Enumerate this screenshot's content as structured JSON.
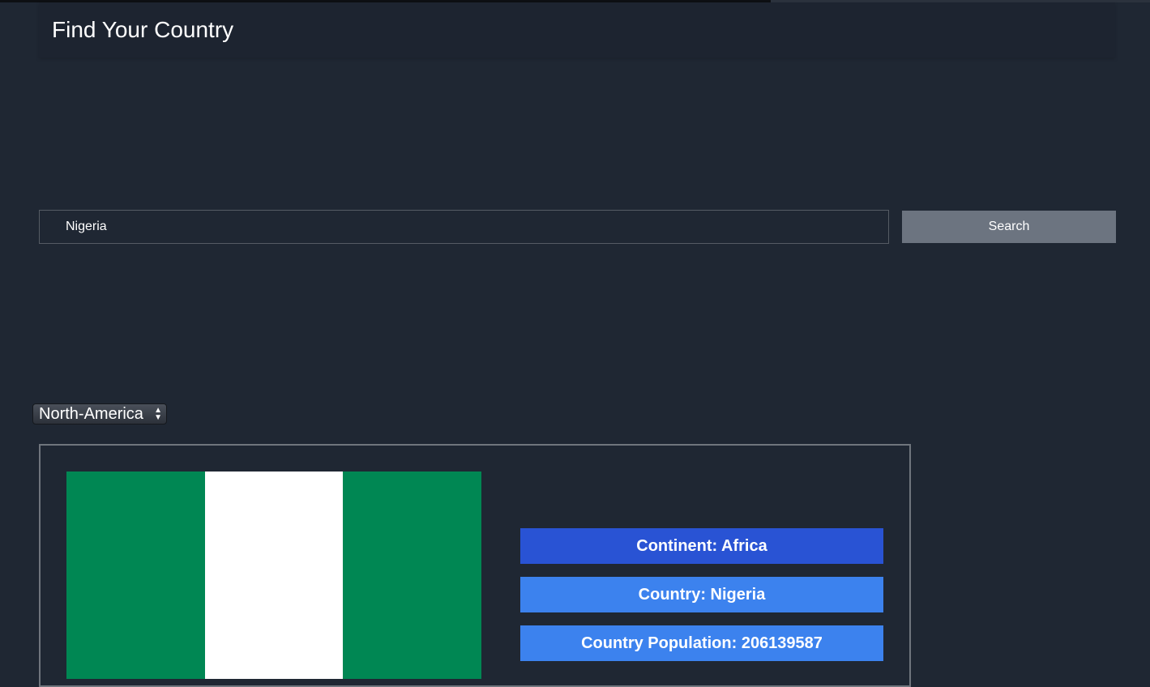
{
  "header": {
    "title": "Find Your Country"
  },
  "loading_bar": {
    "progress_percent": 67
  },
  "search": {
    "value": "Nigeria",
    "button_label": "Search"
  },
  "region_select": {
    "selected": "North-America"
  },
  "result": {
    "flag": {
      "country": "Nigeria",
      "stripe_colors": [
        "#008753",
        "#ffffff",
        "#008753"
      ]
    },
    "continent_label": "Continent: Africa",
    "country_label": "Country: Nigeria",
    "population_label": "Country Population: 206139587"
  },
  "colors": {
    "background": "#1f2733",
    "continent_button": "#2953d4",
    "info_button": "#3c82ee",
    "search_button": "#6c7480"
  }
}
